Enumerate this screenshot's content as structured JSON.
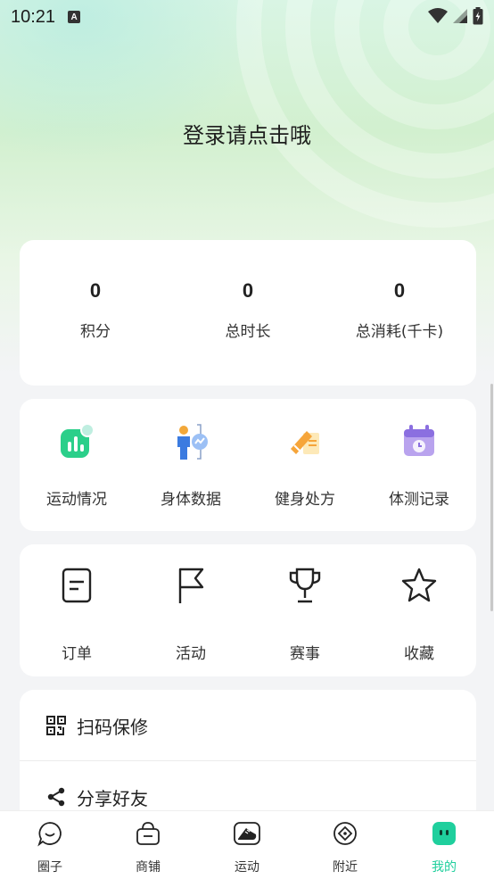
{
  "status_bar": {
    "time": "10:21",
    "notif_badge": "A"
  },
  "header": {
    "login_prompt": "登录请点击哦"
  },
  "stats": [
    {
      "value": "0",
      "label": "积分"
    },
    {
      "value": "0",
      "label": "总时长"
    },
    {
      "value": "0",
      "label": "总消耗(千卡)"
    }
  ],
  "health_tools": [
    {
      "label": "运动情况",
      "icon": "bar-chart-icon"
    },
    {
      "label": "身体数据",
      "icon": "body-data-icon"
    },
    {
      "label": "健身处方",
      "icon": "prescription-icon"
    },
    {
      "label": "体测记录",
      "icon": "calendar-record-icon"
    }
  ],
  "services": [
    {
      "label": "订单",
      "icon": "order-icon"
    },
    {
      "label": "活动",
      "icon": "flag-icon"
    },
    {
      "label": "赛事",
      "icon": "trophy-icon"
    },
    {
      "label": "收藏",
      "icon": "star-icon"
    }
  ],
  "list_items": [
    {
      "label": "扫码保修",
      "icon": "qr-code-icon"
    },
    {
      "label": "分享好友",
      "icon": "share-icon"
    }
  ],
  "tabbar": {
    "active_index": 4,
    "accent": "#1fcf9d",
    "items": [
      {
        "label": "圈子",
        "icon": "chat-bubble-icon"
      },
      {
        "label": "商铺",
        "icon": "basket-icon"
      },
      {
        "label": "运动",
        "icon": "sneaker-icon"
      },
      {
        "label": "附近",
        "icon": "compass-icon"
      },
      {
        "label": "我的",
        "icon": "profile-icon"
      }
    ]
  }
}
